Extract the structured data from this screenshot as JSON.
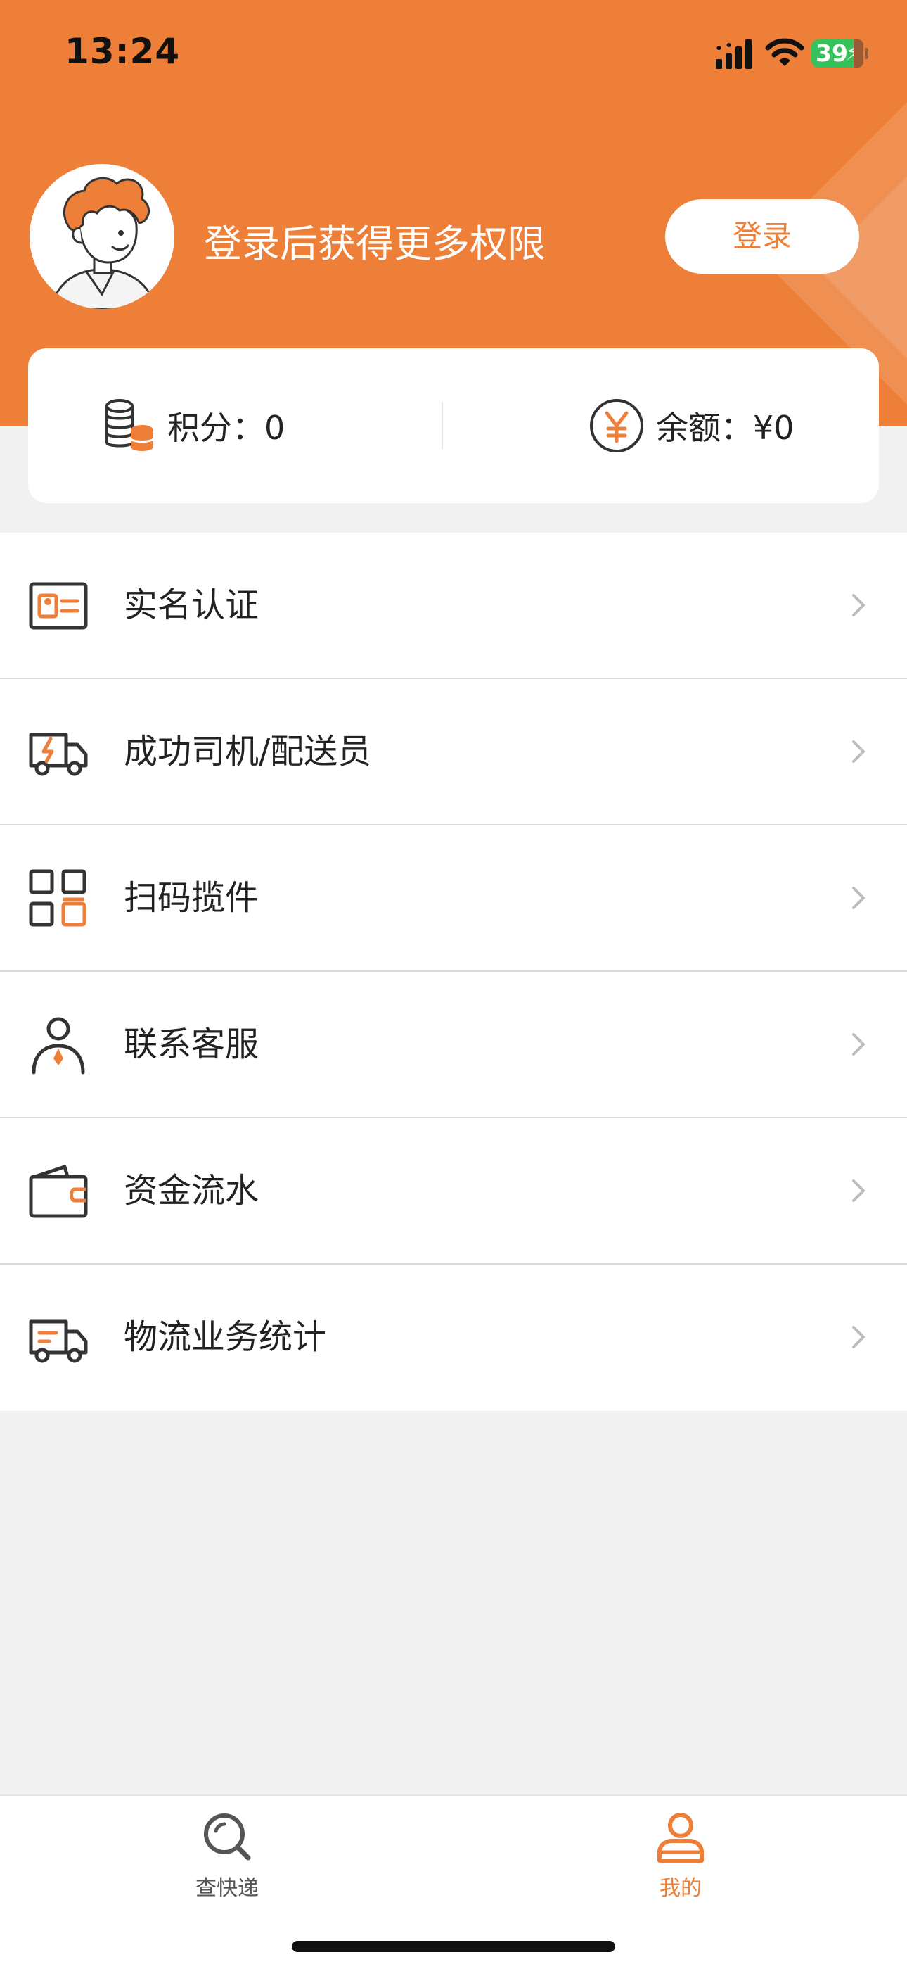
{
  "status_bar": {
    "time": "13:24",
    "battery": "39"
  },
  "header": {
    "login_prompt": "登录后获得更多权限",
    "login_button": "登录"
  },
  "stats": {
    "points_label": "积分：0",
    "balance_label": "余额：¥0"
  },
  "menu": {
    "items": [
      {
        "label": "实名认证",
        "icon": "id-card-icon"
      },
      {
        "label": "成功司机/配送员",
        "icon": "delivery-truck-icon"
      },
      {
        "label": "扫码揽件",
        "icon": "qr-code-icon"
      },
      {
        "label": "联系客服",
        "icon": "customer-service-icon"
      },
      {
        "label": "资金流水",
        "icon": "wallet-icon"
      },
      {
        "label": "物流业务统计",
        "icon": "logistics-truck-icon"
      }
    ]
  },
  "tabbar": {
    "tabs": [
      {
        "label": "查快递",
        "icon": "search-icon",
        "active": false
      },
      {
        "label": "我的",
        "icon": "user-icon",
        "active": true
      }
    ]
  },
  "colors": {
    "accent": "#ed7f39",
    "background": "#f1f1f1",
    "text": "#222222"
  }
}
